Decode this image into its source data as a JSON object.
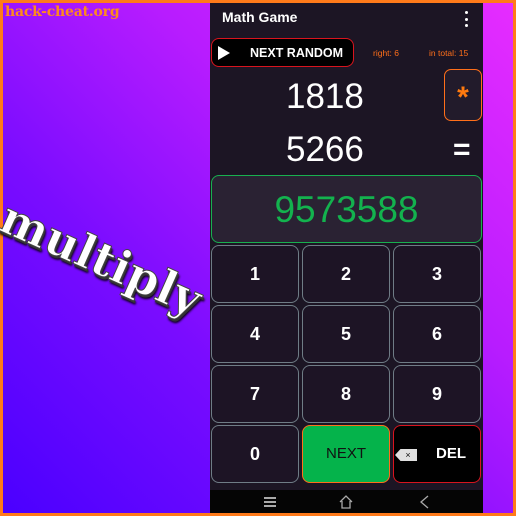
{
  "watermark": "hack-cheat.org",
  "overlay_caption": "multiply",
  "app": {
    "title": "Math Game",
    "menu_icon": "more-vert-icon"
  },
  "controls": {
    "next_random_label": "NEXT RANDOM",
    "play_icon": "play-icon",
    "right_label": "right: 6",
    "total_label": "in total: 15"
  },
  "problem": {
    "operand1": "1818",
    "operand2": "5266",
    "operator": "*",
    "equals": "=",
    "answer": "9573588"
  },
  "keypad": {
    "keys": [
      "1",
      "2",
      "3",
      "4",
      "5",
      "6",
      "7",
      "8",
      "9",
      "0"
    ],
    "next_label": "NEXT",
    "del_label": "DEL",
    "del_icon_glyph": "×"
  },
  "colors": {
    "accent_orange": "#ff6f1a",
    "answer_green": "#13b24e",
    "next_green": "#05b34b",
    "del_red": "#d8141e",
    "panel_bg": "#1c1524"
  },
  "navbar": {
    "icons": [
      "recent-apps-icon",
      "home-icon",
      "back-icon"
    ]
  }
}
